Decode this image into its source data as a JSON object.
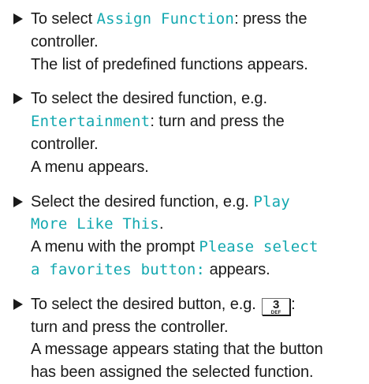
{
  "steps": [
    {
      "l1_a": "To select ",
      "l1_ui": "Assign Function",
      "l1_b": ": press the",
      "l2": "controller.",
      "r1": "The list of predefined functions appears."
    },
    {
      "l1": "To select the desired function, e.g.",
      "l2_ui": "Entertainment",
      "l2_b": ": turn and press the",
      "l3": "controller.",
      "r1": "A menu appears."
    },
    {
      "l1_a": "Select the desired function, e.g. ",
      "l1_ui": "Play",
      "l2_ui": "More Like This",
      "l2_b": ".",
      "r1_a": "A menu with the prompt ",
      "r1_ui": "Please select",
      "r2_ui": "a favorites button:",
      "r2_b": " appears."
    },
    {
      "l1_a": "To select the desired button, e.g. ",
      "key_num": "3",
      "key_sub": "DEF",
      "l1_b": ":",
      "l2": "turn and press the controller.",
      "r1": "A message appears stating that the button",
      "r2": "has been assigned the selected function."
    }
  ],
  "colors": {
    "ui_text": "#13a8b0",
    "body_text": "#1a1a1a"
  }
}
